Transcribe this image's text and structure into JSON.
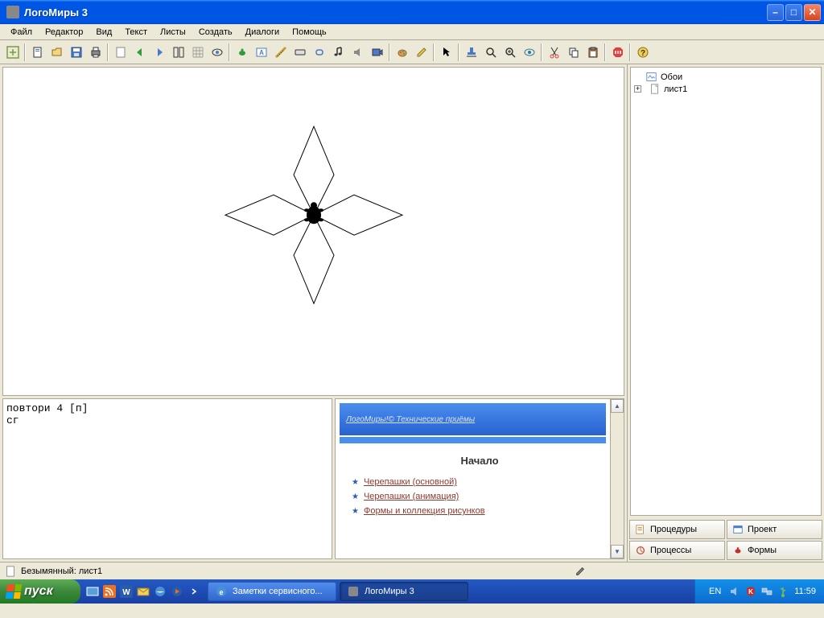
{
  "window": {
    "title": "ЛогоМиры 3"
  },
  "menu": [
    "Файл",
    "Редактор",
    "Вид",
    "Текст",
    "Листы",
    "Создать",
    "Диалоги",
    "Помощь"
  ],
  "tree": {
    "root": "Обои",
    "child": "лист1"
  },
  "commands": {
    "line1": "повтори 4 [п]",
    "line2": "сг"
  },
  "help": {
    "banner": "ЛогоМиры!© Технические приёмы",
    "section": "Начало",
    "links": [
      "Черепашки (основной)",
      "Черепашки (анимация)",
      "Формы и коллекция рисунков"
    ]
  },
  "sidebar_tabs": {
    "procedures": "Процедуры",
    "project": "Проект",
    "processes": "Процессы",
    "forms": "Формы"
  },
  "status": {
    "text": "Безымянный: лист1"
  },
  "taskbar": {
    "start": "пуск",
    "tasks": [
      "Заметки сервисного...",
      "ЛогоМиры 3"
    ],
    "lang": "EN",
    "time": "11:59"
  }
}
